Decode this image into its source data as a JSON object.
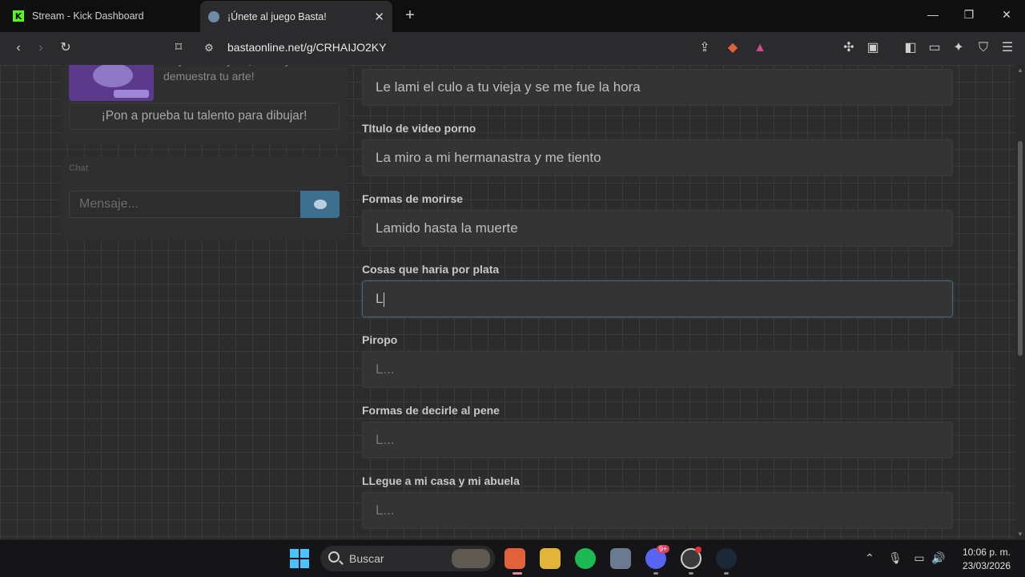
{
  "browser": {
    "tabs": [
      {
        "title": "Stream - Kick Dashboard",
        "icon": "kick-icon",
        "icon_letter": "K"
      },
      {
        "title": "¡Únete al juego Basta!",
        "icon": "globe-icon",
        "active": true
      }
    ],
    "new_tab": "+",
    "url": "bastaonline.net/g/CRHAIJO2KY"
  },
  "sidebar": {
    "promo_text": "mejores dibujos. ¡Únete y demuestra tu arte!",
    "promo_button": "¡Pon a prueba tu talento para dibujar!",
    "chat_title": "Chat",
    "chat_placeholder": "Mensaje..."
  },
  "form": {
    "fields": [
      {
        "label": "",
        "value": "Le lami el culo a tu vieja y se me fue la hora"
      },
      {
        "label": "TItulo de video porno",
        "value": "La miro a mi hermanastra y me tiento"
      },
      {
        "label": "Formas de morirse",
        "value": "Lamido hasta la muerte"
      },
      {
        "label": "Cosas que haria por plata",
        "value": "L"
      },
      {
        "label": "Piropo",
        "placeholder": "L..."
      },
      {
        "label": "Formas de decirle al pene",
        "placeholder": "L..."
      },
      {
        "label": "LLegue a mi casa y mi abuela",
        "placeholder": "L..."
      }
    ]
  },
  "taskbar": {
    "search_label": "Buscar",
    "discord_badge": "9+",
    "time": "10:06 p. m.",
    "date": "23/03/2026"
  },
  "colors": {
    "accent": "#3d6f8f",
    "kick": "#53fc18",
    "windows": "#4cc2ff"
  }
}
